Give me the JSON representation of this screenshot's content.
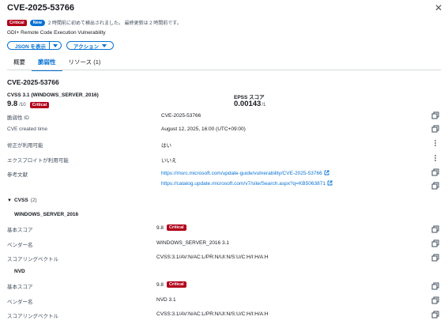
{
  "header": {
    "title": "CVE-2025-53766",
    "close_glyph": "✕",
    "severity_badge": "Critical",
    "new_badge": "New",
    "subtitle": "2 時間前に初めて検出されました。 最終更新は 2 時間前です。",
    "vuln_name": "GDI+ Remote Code Execution Vulnerability",
    "json_button": "JSON を表示",
    "actions_button": "アクション"
  },
  "tabs": [
    {
      "label": "概要",
      "active": false
    },
    {
      "label": "脆弱性",
      "active": true
    },
    {
      "label": "リソース (1)",
      "active": false
    }
  ],
  "details": {
    "heading": "CVE-2025-53766",
    "cvss_label": "CVSS 3.1 (WINDOWS_SERVER_2016)",
    "cvss_score": "9.8",
    "cvss_max": "/10",
    "cvss_badge": "Critical",
    "epss_label": "EPSS スコア",
    "epss_score": "0.00143",
    "epss_max": "/1",
    "rows": [
      {
        "key": "脆弱性 ID",
        "value": "CVE-2025-53766",
        "icon": "copy-icon"
      },
      {
        "key": "CVE created time",
        "value": "August 12, 2025, 16:00 (UTC+09:00)",
        "icon": "copy-icon"
      },
      {
        "key": "修正が利用可能",
        "value": "はい",
        "icon": "more-icon"
      },
      {
        "key": "エクスプロイトが利用可能",
        "value": "いいえ",
        "icon": "more-icon"
      }
    ],
    "references_label": "参考文献",
    "references": [
      "https://msrc.microsoft.com/update-guide/vulnerability/CVE-2025-53766",
      "https://catalog.update.microsoft.com/v7/site/Search.aspx?q=KB5063871"
    ]
  },
  "cvss_section": {
    "toggle": "▼",
    "title": "CVSS",
    "count": "(2)",
    "groups": [
      {
        "name": "WINDOWS_SERVER_2016",
        "base_score_label": "基本スコア",
        "base_score": "9.8",
        "badge": "Critical",
        "vendor_label": "ベンダー名",
        "vendor": "WINDOWS_SERVER_2016 3.1",
        "vector_label": "スコアリングベクトル",
        "vector": "CVSS:3.1/AV:N/AC:L/PR:N/UI:N/S:U/C:H/I:H/A:H"
      },
      {
        "name": "NVD",
        "base_score_label": "基本スコア",
        "base_score": "9.8",
        "badge": "Critical",
        "vendor_label": "ベンダー名",
        "vendor": "NVD 3.1",
        "vector_label": "スコアリングベクトル",
        "vector": "CVSS:3.1/AV:N/AC:L/PR:N/UI:N/S:U/C:H/I:H/A:H"
      }
    ]
  },
  "colors": {
    "accent": "#0972d3",
    "critical": "#b1001a"
  }
}
